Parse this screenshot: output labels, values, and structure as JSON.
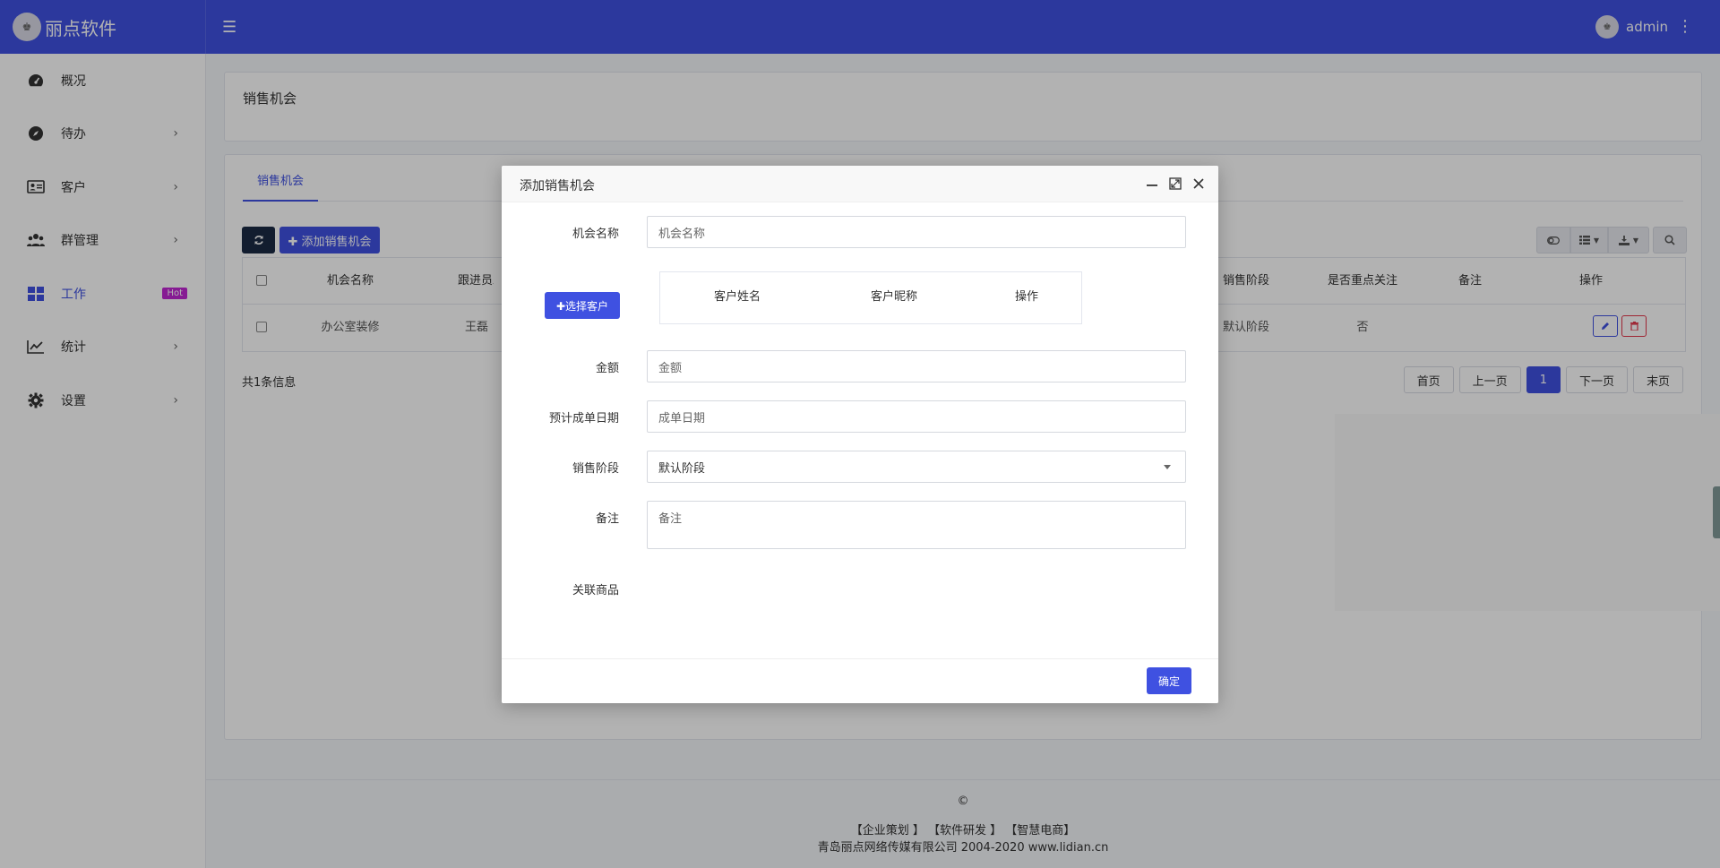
{
  "brand": {
    "name": "丽点软件",
    "logo_glyph": "♚"
  },
  "header": {
    "menu_icon": "☰",
    "username": "admin"
  },
  "sidebar": {
    "items": [
      {
        "label": "概况",
        "icon": "dashboard-icon",
        "has_children": false
      },
      {
        "label": "待办",
        "icon": "compass-icon",
        "has_children": true
      },
      {
        "label": "客户",
        "icon": "id-card-icon",
        "has_children": true
      },
      {
        "label": "群管理",
        "icon": "users-icon",
        "has_children": true
      },
      {
        "label": "工作",
        "icon": "grid-icon",
        "has_children": false,
        "active": true,
        "badge": "Hot"
      },
      {
        "label": "统计",
        "icon": "line-chart-icon",
        "has_children": true
      },
      {
        "label": "设置",
        "icon": "gear-icon",
        "has_children": true
      }
    ]
  },
  "page": {
    "title": "销售机会",
    "tab": "销售机会",
    "add_button": "✚ 添加销售机会",
    "table": {
      "headers": [
        "机会名称",
        "跟进员工",
        "销售阶段",
        "是否重点关注",
        "备注",
        "操作"
      ],
      "rows": [
        {
          "name": "办公室装修",
          "staff": "王磊",
          "stage": "默认阶段",
          "focus": "否",
          "note": ""
        }
      ]
    },
    "count_text": "共1条信息",
    "pager": {
      "first": "首页",
      "prev": "上一页",
      "current": "1",
      "next": "下一页",
      "last": "末页"
    }
  },
  "footer": {
    "copyright": "©",
    "links": "【企业策划 】 【软件研发 】 【智慧电商】",
    "company": "青岛丽点网络传媒有限公司 2004-2020 www.lidian.cn"
  },
  "modal": {
    "title": "添加销售机会",
    "fields": {
      "name_label": "机会名称",
      "name_placeholder": "机会名称",
      "choose_customer": "✚选择客户",
      "customer_headers": [
        "客户姓名",
        "客户昵称",
        "操作"
      ],
      "amount_label": "金额",
      "amount_placeholder": "金额",
      "date_label": "预计成单日期",
      "date_placeholder": "成单日期",
      "stage_label": "销售阶段",
      "stage_value": "默认阶段",
      "note_label": "备注",
      "note_placeholder": "备注",
      "goods_label": "关联商品"
    },
    "ok_button": "确定"
  },
  "colors": {
    "primary": "#3f51e1",
    "dark_button": "#1a2a44",
    "danger": "#e3354a",
    "hot_badge": "#c026d3"
  }
}
